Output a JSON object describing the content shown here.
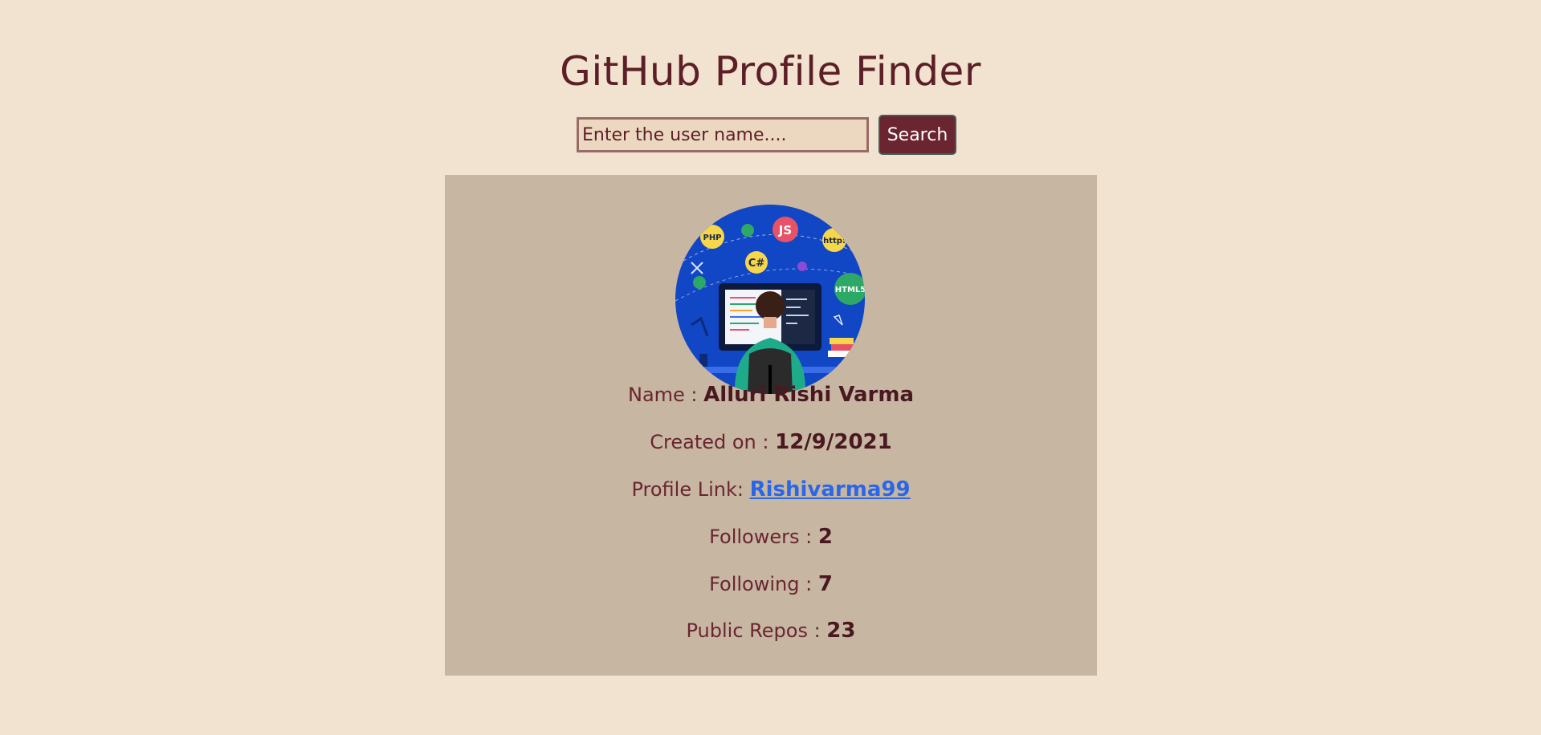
{
  "header": {
    "title": "GitHub Profile Finder"
  },
  "search": {
    "placeholder": "Enter the user name....",
    "value": "",
    "button_label": "Search"
  },
  "profile": {
    "avatar_icon": "developer-at-computer-illustration",
    "name_label": "Name : ",
    "name_value": "Alluri Rishi Varma",
    "created_label": "Created on : ",
    "created_value": "12/9/2021",
    "link_label": "Profile Link: ",
    "link_value": "Rishivarma99",
    "followers_label": "Followers : ",
    "followers_value": "2",
    "following_label": "Following : ",
    "following_value": "7",
    "repos_label": "Public Repos : ",
    "repos_value": "23",
    "avatar_badges": [
      "PHP",
      "JS",
      "C#",
      "http:",
      "HTML5"
    ]
  },
  "colors": {
    "background": "#f1e3cf",
    "card": "#c7b6a2",
    "text": "#5c1f27",
    "button": "#6a2530",
    "link": "#2a67e8"
  }
}
